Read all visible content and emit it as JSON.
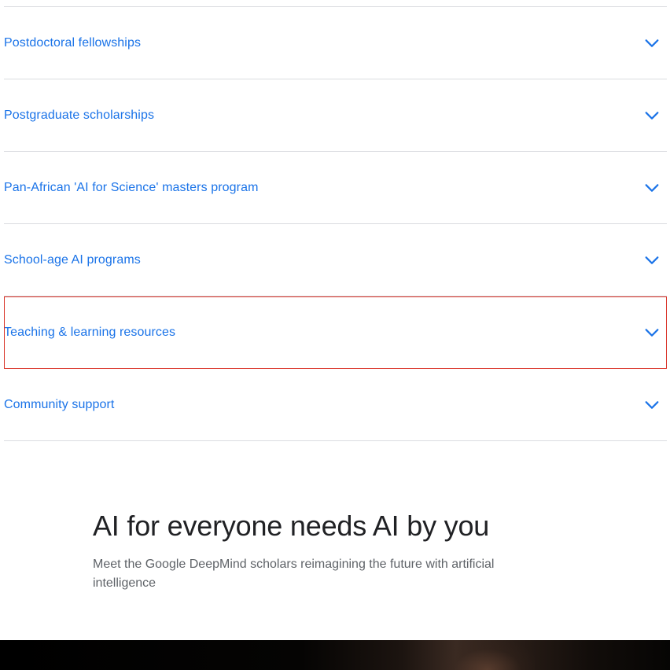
{
  "accordion": {
    "items": [
      {
        "label": "Postdoctoral fellowships",
        "icon": "chevron-down-icon"
      },
      {
        "label": "Postgraduate scholarships",
        "icon": "chevron-down-icon"
      },
      {
        "label": "Pan-African 'AI for Science' masters program",
        "icon": "chevron-down-icon"
      },
      {
        "label": "School-age AI programs",
        "icon": "chevron-down-icon"
      },
      {
        "label": "Teaching & learning resources",
        "icon": "chevron-down-icon"
      },
      {
        "label": "Community support",
        "icon": "chevron-down-icon"
      }
    ],
    "accent_color": "#1a73e8",
    "focus_color": "#d93025"
  },
  "promo": {
    "title": "AI for everyone needs AI by you",
    "subtitle": "Meet the Google DeepMind scholars reimagining the future with artificial intelligence"
  }
}
